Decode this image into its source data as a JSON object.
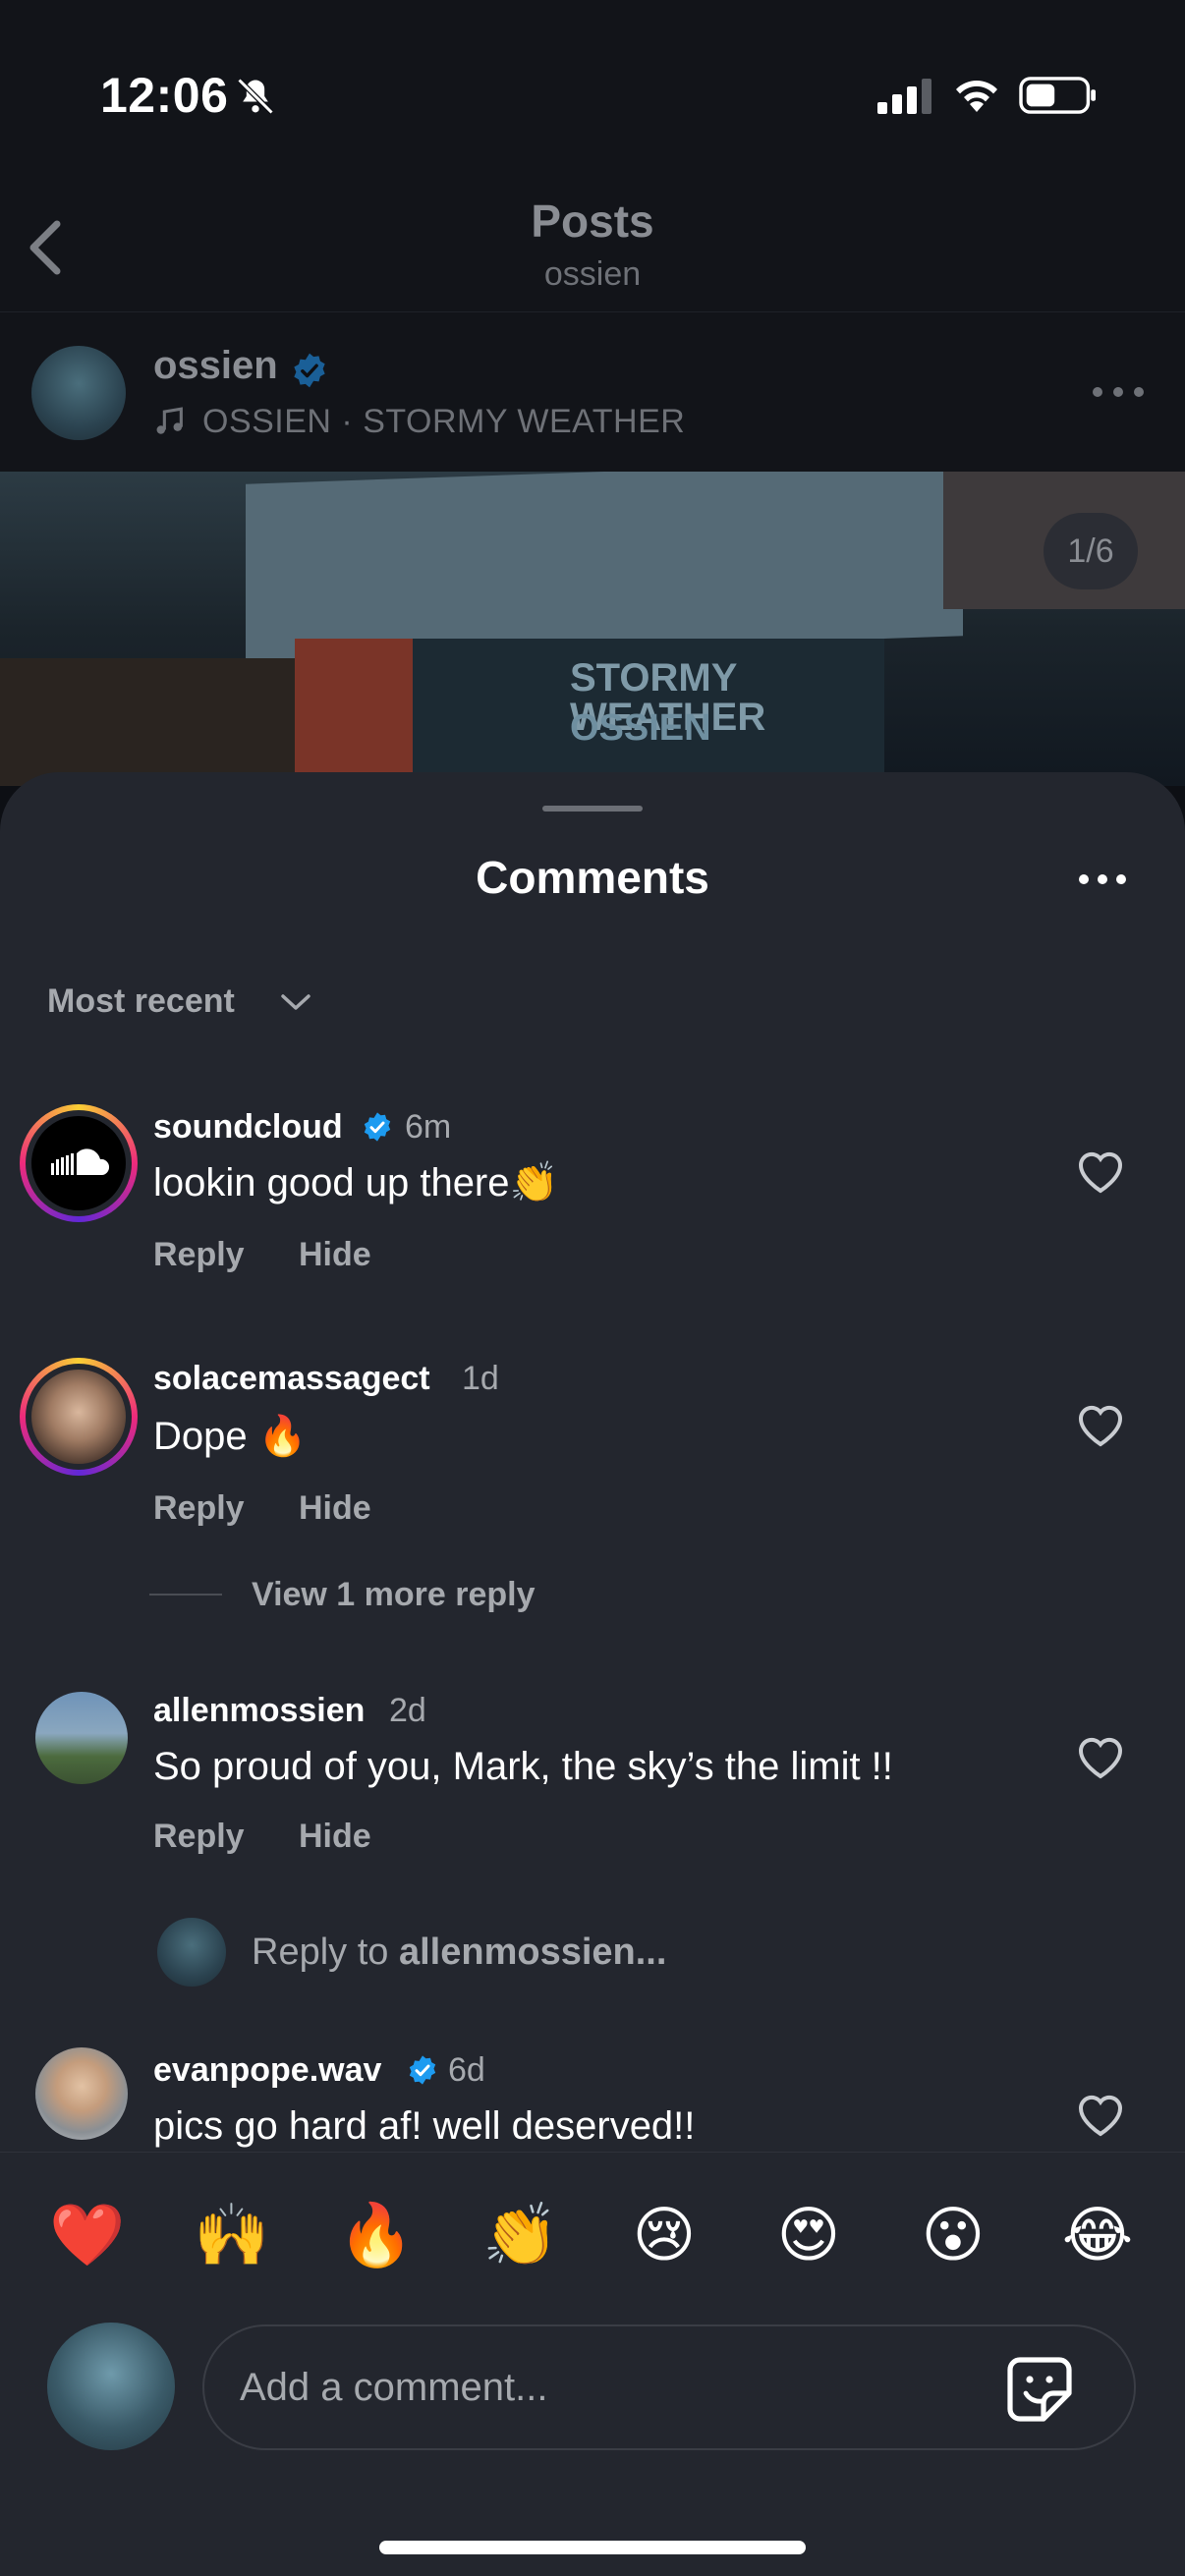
{
  "status_bar": {
    "time": "12:06"
  },
  "header": {
    "title": "Posts",
    "subtitle": "ossien"
  },
  "post": {
    "author": "ossien",
    "song": "OSSIEN · STORMY WEATHER",
    "page_counter": "1/6",
    "image_text": {
      "line1": "STORMY",
      "line2": "WEATHER",
      "artist": "OSSIEN"
    }
  },
  "sheet": {
    "title": "Comments",
    "sort_label": "Most recent"
  },
  "comments": [
    {
      "user": "soundcloud",
      "time": "6m",
      "text": "lookin good up there👏",
      "reply": "Reply",
      "hide": "Hide"
    },
    {
      "user": "solacemassagect",
      "time": "1d",
      "text": "Dope 🔥",
      "reply": "Reply",
      "hide": "Hide",
      "view_more": "View 1 more reply"
    },
    {
      "user": "allenmossien",
      "time": "2d",
      "text": "So proud of you, Mark, the sky’s the limit !!",
      "reply": "Reply",
      "hide": "Hide"
    },
    {
      "user": "evanpope.wav",
      "time": "6d",
      "text": "pics go hard af! well deserved!!"
    }
  ],
  "reply_prompt": {
    "prefix": "Reply to ",
    "user": "allenmossien..."
  },
  "emojis": [
    "❤️",
    "🙌",
    "🔥",
    "👏",
    "😢",
    "😍",
    "😮",
    "😂"
  ],
  "composer": {
    "placeholder": "Add a comment..."
  },
  "colors": {
    "sheet_bg": "#23262e",
    "verified": "#1d9bf0",
    "muted_text": "#a6a9ae"
  }
}
